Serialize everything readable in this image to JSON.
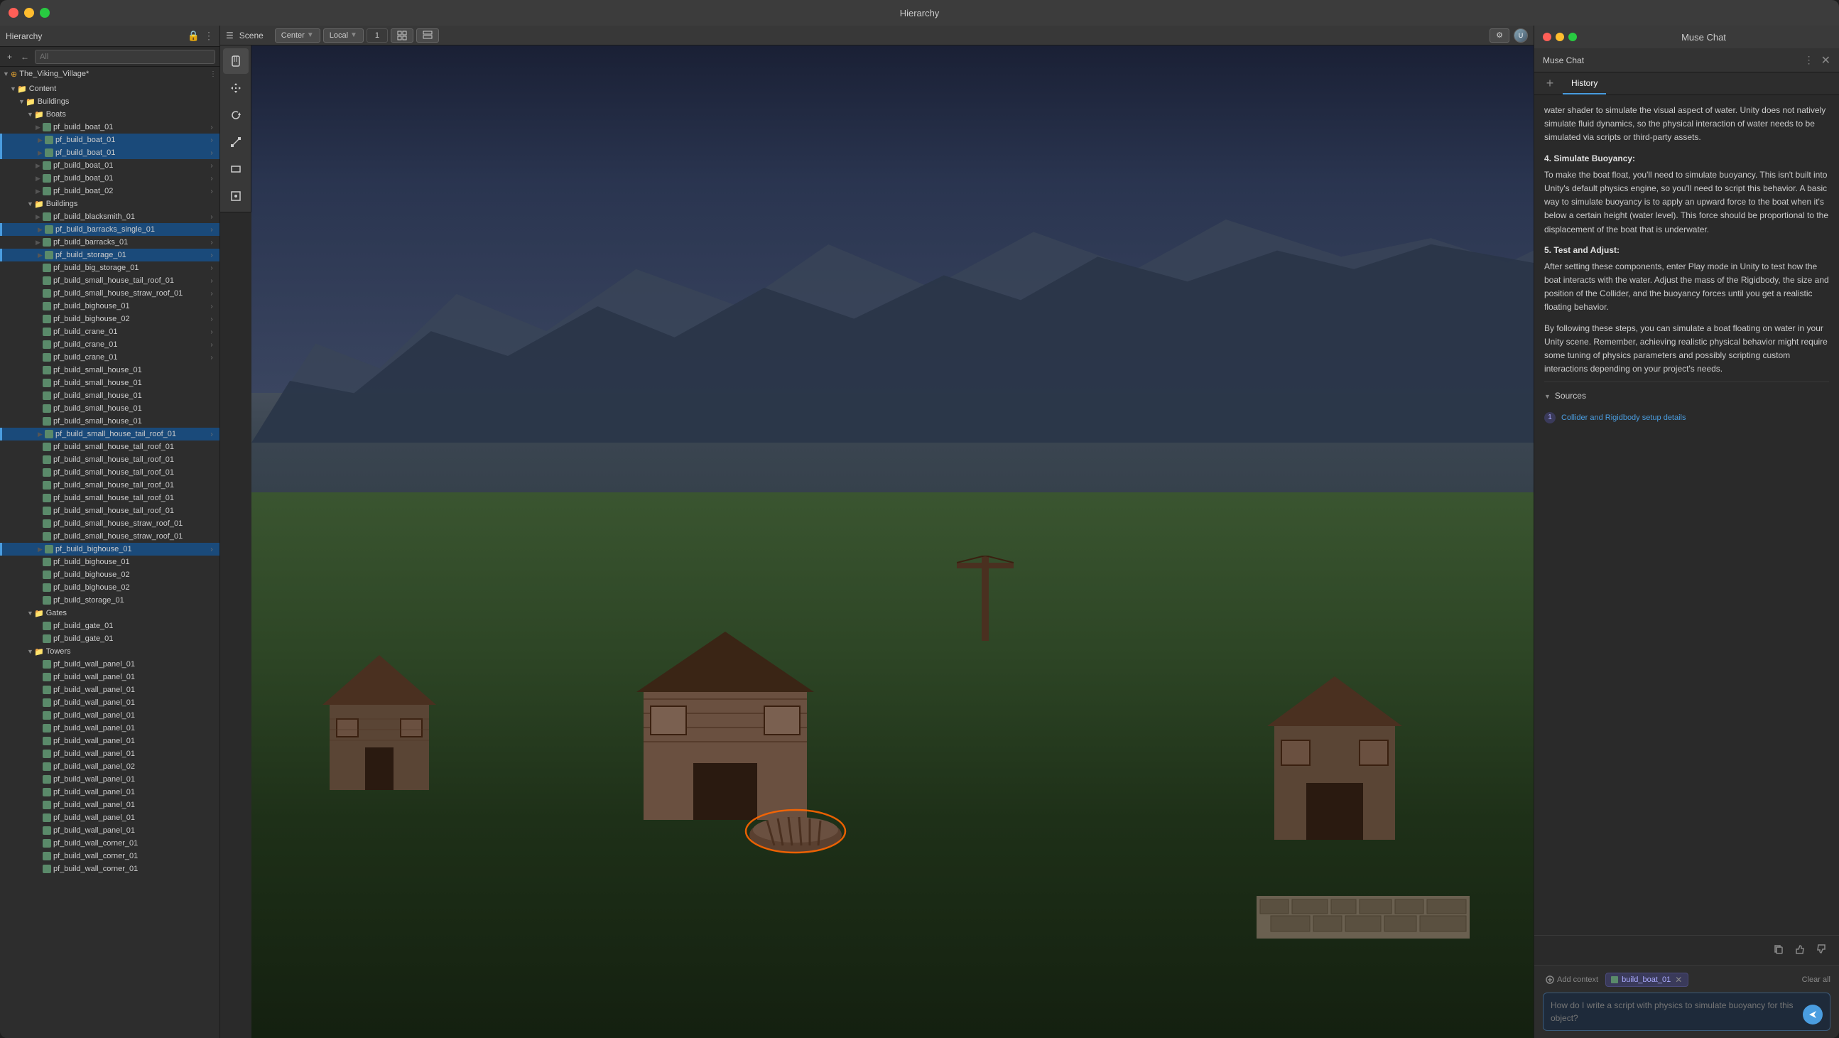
{
  "window": {
    "title": "Hierarchy"
  },
  "hierarchy": {
    "panel_title": "Hierarchy",
    "search_placeholder": "All",
    "root": "The_Viking_Village*",
    "items": [
      {
        "label": "Content",
        "depth": 1,
        "type": "folder",
        "expanded": true
      },
      {
        "label": "Buildings",
        "depth": 2,
        "type": "folder",
        "expanded": true
      },
      {
        "label": "Boats",
        "depth": 3,
        "type": "folder",
        "expanded": true
      },
      {
        "label": "pf_build_boat_01",
        "depth": 4,
        "type": "prefab",
        "selected": false
      },
      {
        "label": "pf_build_boat_01",
        "depth": 4,
        "type": "prefab",
        "selected": true
      },
      {
        "label": "pf_build_boat_01",
        "depth": 4,
        "type": "prefab",
        "selected": false
      },
      {
        "label": "pf_build_boat_01",
        "depth": 4,
        "type": "prefab",
        "selected": false
      },
      {
        "label": "pf_build_boat_01",
        "depth": 4,
        "type": "prefab",
        "selected": false
      },
      {
        "label": "pf_build_boat_02",
        "depth": 4,
        "type": "prefab",
        "selected": false
      },
      {
        "label": "Buildings",
        "depth": 3,
        "type": "folder",
        "expanded": true
      },
      {
        "label": "pf_build_blacksmith_01",
        "depth": 4,
        "type": "prefab",
        "selected": false
      },
      {
        "label": "pf_build_barracks_single_01",
        "depth": 4,
        "type": "prefab",
        "selected": true
      },
      {
        "label": "pf_build_barracks_01",
        "depth": 4,
        "type": "prefab",
        "selected": false
      },
      {
        "label": "pf_build_storage_01",
        "depth": 4,
        "type": "prefab",
        "selected": true
      },
      {
        "label": "pf_build_big_storage_01",
        "depth": 4,
        "type": "prefab",
        "selected": false
      },
      {
        "label": "pf_build_small_house_tail_roof_01",
        "depth": 4,
        "type": "prefab",
        "selected": false
      },
      {
        "label": "pf_build_small_house_straw_roof_01",
        "depth": 4,
        "type": "prefab",
        "selected": false
      },
      {
        "label": "pf_build_bighouse_01",
        "depth": 4,
        "type": "prefab",
        "selected": false
      },
      {
        "label": "pf_build_bighouse_02",
        "depth": 4,
        "type": "prefab",
        "selected": false
      },
      {
        "label": "pf_build_crane_01",
        "depth": 4,
        "type": "prefab",
        "selected": false
      },
      {
        "label": "pf_build_crane_01",
        "depth": 4,
        "type": "prefab",
        "selected": false
      },
      {
        "label": "pf_build_crane_01",
        "depth": 4,
        "type": "prefab",
        "selected": false
      },
      {
        "label": "pf_build_small_house_01",
        "depth": 4,
        "type": "prefab",
        "selected": false
      },
      {
        "label": "pf_build_small_house_01",
        "depth": 4,
        "type": "prefab",
        "selected": false
      },
      {
        "label": "pf_build_small_house_01",
        "depth": 4,
        "type": "prefab",
        "selected": false
      },
      {
        "label": "pf_build_small_house_01",
        "depth": 4,
        "type": "prefab",
        "selected": false
      },
      {
        "label": "pf_build_small_house_01",
        "depth": 4,
        "type": "prefab",
        "selected": false
      },
      {
        "label": "pf_build_small_house_tail_roof_01",
        "depth": 4,
        "type": "prefab",
        "selected": true
      },
      {
        "label": "pf_build_small_house_tall_roof_01",
        "depth": 4,
        "type": "prefab",
        "selected": false
      },
      {
        "label": "pf_build_small_house_tall_roof_01",
        "depth": 4,
        "type": "prefab",
        "selected": false
      },
      {
        "label": "pf_build_small_house_tall_roof_01",
        "depth": 4,
        "type": "prefab",
        "selected": false
      },
      {
        "label": "pf_build_small_house_tall_roof_01",
        "depth": 4,
        "type": "prefab",
        "selected": false
      },
      {
        "label": "pf_build_small_house_tall_roof_01",
        "depth": 4,
        "type": "prefab",
        "selected": false
      },
      {
        "label": "pf_build_small_house_tall_roof_01",
        "depth": 4,
        "type": "prefab",
        "selected": false
      },
      {
        "label": "pf_build_small_house_straw_roof_01",
        "depth": 4,
        "type": "prefab",
        "selected": false
      },
      {
        "label": "pf_build_small_house_straw_roof_01",
        "depth": 4,
        "type": "prefab",
        "selected": false
      },
      {
        "label": "pf_build_bighouse_01",
        "depth": 4,
        "type": "prefab",
        "selected": true
      },
      {
        "label": "pf_build_bighouse_01",
        "depth": 4,
        "type": "prefab",
        "selected": false
      },
      {
        "label": "pf_build_bighouse_02",
        "depth": 4,
        "type": "prefab",
        "selected": false
      },
      {
        "label": "pf_build_bighouse_02",
        "depth": 4,
        "type": "prefab",
        "selected": false
      },
      {
        "label": "pf_build_storage_01",
        "depth": 4,
        "type": "prefab",
        "selected": false
      },
      {
        "label": "Gates",
        "depth": 3,
        "type": "folder",
        "expanded": true
      },
      {
        "label": "pf_build_gate_01",
        "depth": 4,
        "type": "prefab",
        "selected": false
      },
      {
        "label": "pf_build_gate_01",
        "depth": 4,
        "type": "prefab",
        "selected": false
      },
      {
        "label": "Towers",
        "depth": 3,
        "type": "folder",
        "expanded": true
      },
      {
        "label": "pf_build_wall_panel_01",
        "depth": 4,
        "type": "prefab",
        "selected": false
      },
      {
        "label": "pf_build_wall_panel_01",
        "depth": 4,
        "type": "prefab",
        "selected": false
      },
      {
        "label": "pf_build_wall_panel_01",
        "depth": 4,
        "type": "prefab",
        "selected": false
      },
      {
        "label": "pf_build_wall_panel_01",
        "depth": 4,
        "type": "prefab",
        "selected": false
      },
      {
        "label": "pf_build_wall_panel_01",
        "depth": 4,
        "type": "prefab",
        "selected": false
      },
      {
        "label": "pf_build_wall_panel_01",
        "depth": 4,
        "type": "prefab",
        "selected": false
      },
      {
        "label": "pf_build_wall_panel_01",
        "depth": 4,
        "type": "prefab",
        "selected": false
      },
      {
        "label": "pf_build_wall_panel_01",
        "depth": 4,
        "type": "prefab",
        "selected": false
      },
      {
        "label": "pf_build_wall_panel_02",
        "depth": 4,
        "type": "prefab",
        "selected": false
      },
      {
        "label": "pf_build_wall_panel_01",
        "depth": 4,
        "type": "prefab",
        "selected": false
      },
      {
        "label": "pf_build_wall_panel_01",
        "depth": 4,
        "type": "prefab",
        "selected": false
      },
      {
        "label": "pf_build_wall_panel_01",
        "depth": 4,
        "type": "prefab",
        "selected": false
      },
      {
        "label": "pf_build_wall_panel_01",
        "depth": 4,
        "type": "prefab",
        "selected": false
      },
      {
        "label": "pf_build_wall_panel_01",
        "depth": 4,
        "type": "prefab",
        "selected": false
      },
      {
        "label": "pf_build_wall_corner_01",
        "depth": 4,
        "type": "prefab",
        "selected": false
      },
      {
        "label": "pf_build_wall_corner_01",
        "depth": 4,
        "type": "prefab",
        "selected": false
      },
      {
        "label": "pf_build_wall_corner_01",
        "depth": 4,
        "type": "prefab",
        "selected": false
      }
    ]
  },
  "scene": {
    "title": "Scene",
    "toolbar": {
      "center_label": "Center",
      "local_label": "Local",
      "snap_value": "1"
    }
  },
  "muse_chat": {
    "window_title": "Muse Chat",
    "panel_title": "Muse Chat",
    "tab_add_label": "+",
    "tab_history_label": "History",
    "message": {
      "text_1": "water shader to simulate the visual aspect of water. Unity does not natively simulate fluid dynamics, so the physical interaction of water needs to be simulated via scripts or third-party assets.",
      "step_4_title": "4. Simulate Buoyancy:",
      "step_4_text": "To make the boat float, you'll need to simulate buoyancy. This isn't built into Unity's default physics engine, so you'll need to script this behavior. A basic way to simulate buoyancy is to apply an upward force to the boat when it's below a certain height (water level). This force should be proportional to the displacement of the boat that is underwater.",
      "step_5_title": "5. Test and Adjust:",
      "step_5_text": "After setting these components, enter Play mode in Unity to test how the boat interacts with the water. Adjust the mass of the Rigidbody, the size and position of the Collider, and the buoyancy forces until you get a realistic floating behavior.",
      "closing_text": "By following these steps, you can simulate a boat floating on water in your Unity scene. Remember, achieving realistic physical behavior might require some tuning of physics parameters and possibly scripting custom interactions depending on your project's needs."
    },
    "sources": {
      "header": "Sources",
      "items": [
        {
          "number": "1",
          "label": "Collider and Rigidbody setup details"
        }
      ]
    },
    "input": {
      "context_label": "Add context",
      "clear_all_label": "Clear all",
      "context_tag": "build_boat_01",
      "placeholder": "How do I write a script with physics to simulate buoyancy for this object?"
    },
    "feedback": {
      "copy_icon": "⧉",
      "thumbs_up_icon": "👍",
      "thumbs_down_icon": "👎"
    }
  },
  "tools": {
    "hand": "✋",
    "move": "✛",
    "rotate": "↻",
    "scale": "⤡",
    "rect": "▭",
    "transform": "⊞"
  }
}
